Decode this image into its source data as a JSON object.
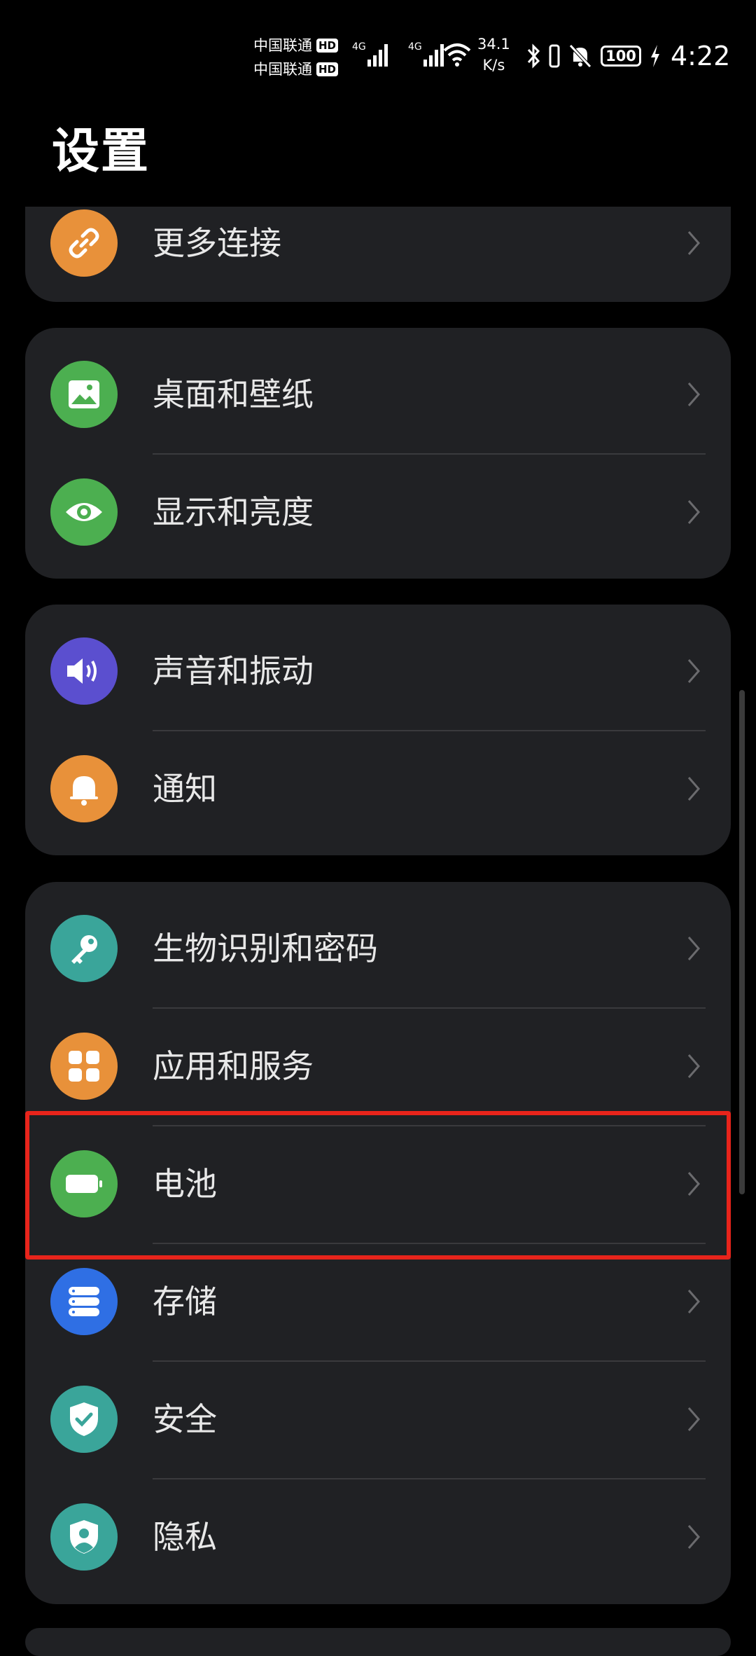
{
  "status_bar": {
    "carrier1": "中国联通",
    "carrier2": "中国联通",
    "hd1": "HD",
    "hd2": "HD",
    "net1": "4G",
    "net2": "4G",
    "speed_value": "34.1",
    "speed_unit": "K/s",
    "battery": "100",
    "time": "4:22"
  },
  "header": {
    "title": "设置"
  },
  "cards": [
    {
      "items": [
        {
          "label": "更多连接",
          "icon": "link-icon",
          "color": "#e8913a"
        }
      ]
    },
    {
      "items": [
        {
          "label": "桌面和壁纸",
          "icon": "wallpaper-icon",
          "color": "#4caf50"
        },
        {
          "label": "显示和亮度",
          "icon": "eye-icon",
          "color": "#4caf50"
        }
      ]
    },
    {
      "items": [
        {
          "label": "声音和振动",
          "icon": "speaker-icon",
          "color": "#5b4fcf"
        },
        {
          "label": "通知",
          "icon": "bell-icon",
          "color": "#e8913a"
        }
      ]
    },
    {
      "items": [
        {
          "label": "生物识别和密码",
          "icon": "key-icon",
          "color": "#3aa59a"
        },
        {
          "label": "应用和服务",
          "icon": "apps-icon",
          "color": "#e8913a"
        },
        {
          "label": "电池",
          "icon": "battery-icon",
          "color": "#4caf50"
        },
        {
          "label": "存储",
          "icon": "storage-icon",
          "color": "#2f6fe4"
        },
        {
          "label": "安全",
          "icon": "shield-icon",
          "color": "#3aa59a"
        },
        {
          "label": "隐私",
          "icon": "privacy-icon",
          "color": "#3aa59a"
        }
      ]
    }
  ],
  "colors": {
    "highlight": "#e8241b",
    "card_bg": "#202124",
    "background": "#000000"
  }
}
